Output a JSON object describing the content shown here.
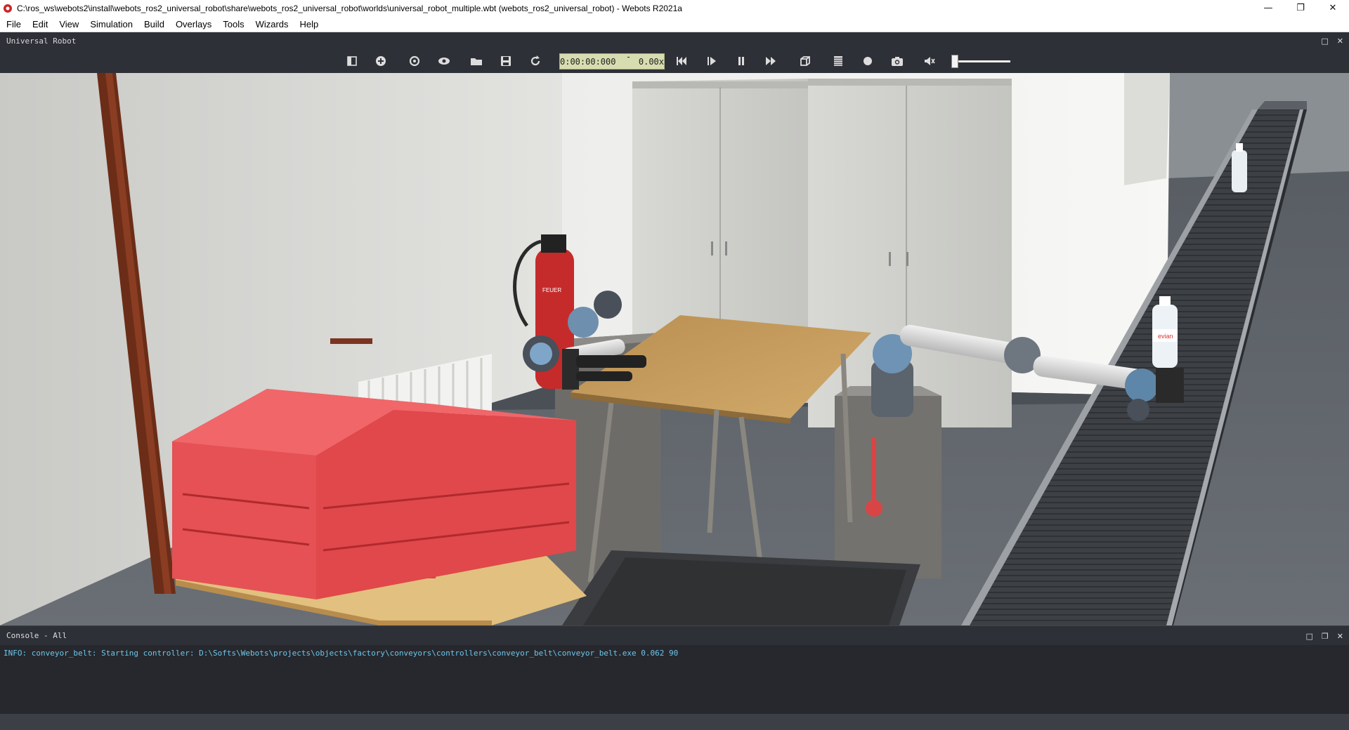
{
  "window": {
    "title": "C:\\ros_ws\\webots2\\install\\webots_ros2_universal_robot\\share\\webots_ros2_universal_robot\\worlds\\universal_robot_multiple.wbt (webots_ros2_universal_robot) - Webots R2021a",
    "minimize_glyph": "—",
    "restore_glyph": "❐",
    "close_glyph": "✕"
  },
  "menu": {
    "items": [
      "File",
      "Edit",
      "View",
      "Simulation",
      "Build",
      "Overlays",
      "Tools",
      "Wizards",
      "Help"
    ]
  },
  "view3d": {
    "title": "Universal Robot",
    "float_glyph": "□",
    "close_glyph": "✕"
  },
  "toolbar": {
    "icons": [
      "scene-tree-toggle-icon",
      "add-node-icon",
      "reload-world-icon",
      "viewpoint-eye-icon",
      "open-world-icon",
      "save-world-icon",
      "reset-simulation-icon",
      "step-back-icon",
      "play-icon",
      "pause-icon",
      "fast-forward-icon",
      "view-cube-icon",
      "movie-icon",
      "record-icon",
      "screenshot-icon",
      "sound-icon"
    ],
    "time": "0:00:00:000",
    "speed": "0.00x",
    "volume": 0.0
  },
  "console": {
    "title": "Console - All",
    "line": "INFO: conveyor_belt: Starting controller: D:\\Softs\\Webots\\projects\\objects\\factory\\conveyors\\controllers\\conveyor_belt\\conveyor_belt.exe 0.062 90"
  },
  "scene": {
    "bottle_label": "evian",
    "extinguisher_label": "FEUER"
  },
  "colors": {
    "toolbar_bg": "#2e3037",
    "time_box": "#d7ddb0",
    "console_text": "#6fc6e8",
    "crate_red": "#e0484b"
  }
}
